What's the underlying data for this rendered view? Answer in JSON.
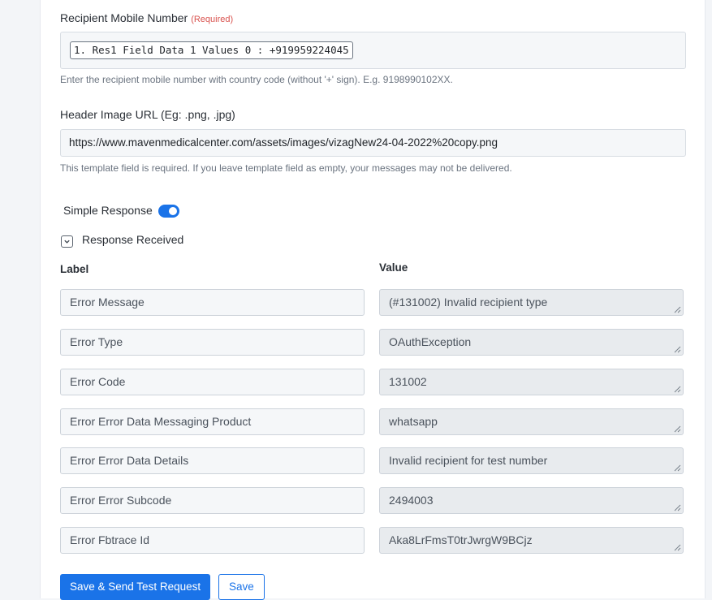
{
  "recipient": {
    "label": "Recipient Mobile Number",
    "required": "(Required)",
    "chip_value": "1. Res1 Field Data 1 Values 0 : +919959224045",
    "hint": "Enter the recipient mobile number with country code (without '+' sign). E.g. 9198990102XX."
  },
  "header_image": {
    "label": "Header Image URL (Eg: .png, .jpg)",
    "value": "https://www.mavenmedicalcenter.com/assets/images/vizagNew24-04-2022%20copy.png",
    "hint": "This template field is required. If you leave template field as empty, your messages may not be delivered."
  },
  "simple_response": {
    "label": "Simple Response",
    "enabled": true
  },
  "response_received": {
    "label": "Response Received"
  },
  "table": {
    "label_header": "Label",
    "value_header": "Value",
    "rows": [
      {
        "label": "Error Message",
        "value": "(#131002) Invalid recipient type"
      },
      {
        "label": "Error Type",
        "value": "OAuthException"
      },
      {
        "label": "Error Code",
        "value": "131002"
      },
      {
        "label": "Error Error Data Messaging Product",
        "value": "whatsapp"
      },
      {
        "label": "Error Error Data Details",
        "value": "Invalid recipient for test number"
      },
      {
        "label": "Error Error Subcode",
        "value": "2494003"
      },
      {
        "label": "Error Fbtrace Id",
        "value": "Aka8LrFmsT0trJwrgW9BCjz"
      }
    ]
  },
  "buttons": {
    "save_send": "Save & Send Test Request",
    "save": "Save"
  },
  "colors": {
    "accent": "#1a73e8",
    "required": "#d9534f"
  }
}
